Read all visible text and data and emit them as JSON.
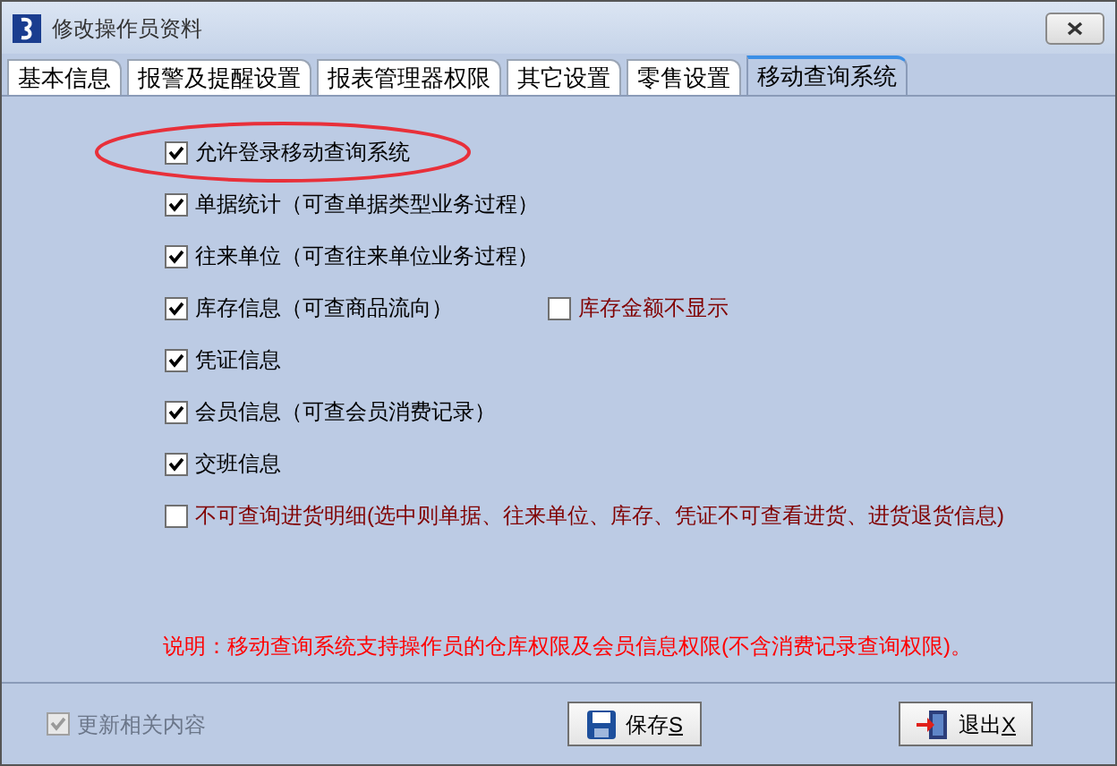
{
  "window": {
    "title": "修改操作员资料"
  },
  "tabs": [
    {
      "label": "基本信息",
      "selected": false
    },
    {
      "label": "报警及提醒设置",
      "selected": false
    },
    {
      "label": "报表管理器权限",
      "selected": false
    },
    {
      "label": "其它设置",
      "selected": false
    },
    {
      "label": "零售设置",
      "selected": false
    },
    {
      "label": "移动查询系统",
      "selected": true
    }
  ],
  "options": [
    {
      "label": "允许登录移动查询系统",
      "checked": true,
      "color": "#000000",
      "circled": true
    },
    {
      "label": "单据统计（可查单据类型业务过程）",
      "checked": true,
      "color": "#000000",
      "circled": false
    },
    {
      "label": "往来单位（可查往来单位业务过程）",
      "checked": true,
      "color": "#000000",
      "circled": false
    },
    {
      "label": "库存信息（可查商品流向）",
      "checked": true,
      "color": "#000000",
      "circled": false,
      "side": {
        "label": "库存金额不显示",
        "checked": false,
        "color": "#800000"
      }
    },
    {
      "label": "凭证信息",
      "checked": true,
      "color": "#000000",
      "circled": false
    },
    {
      "label": "会员信息（可查会员消费记录）",
      "checked": true,
      "color": "#000000",
      "circled": false
    },
    {
      "label": "交班信息",
      "checked": true,
      "color": "#000000",
      "circled": false
    },
    {
      "label": "不可查询进货明细(选中则单据、往来单位、库存、凭证不可查看进货、进货退货信息)",
      "checked": false,
      "color": "#800000",
      "circled": false
    }
  ],
  "note": "说明：移动查询系统支持操作员的仓库权限及会员信息权限(不含消费记录查询权限)。",
  "update": {
    "label": "更新相关内容",
    "checked": true,
    "disabled": true
  },
  "buttons": [
    {
      "kind": "save",
      "label": "保存",
      "accel": "S"
    },
    {
      "kind": "exit",
      "label": "退出",
      "accel": "X"
    }
  ]
}
